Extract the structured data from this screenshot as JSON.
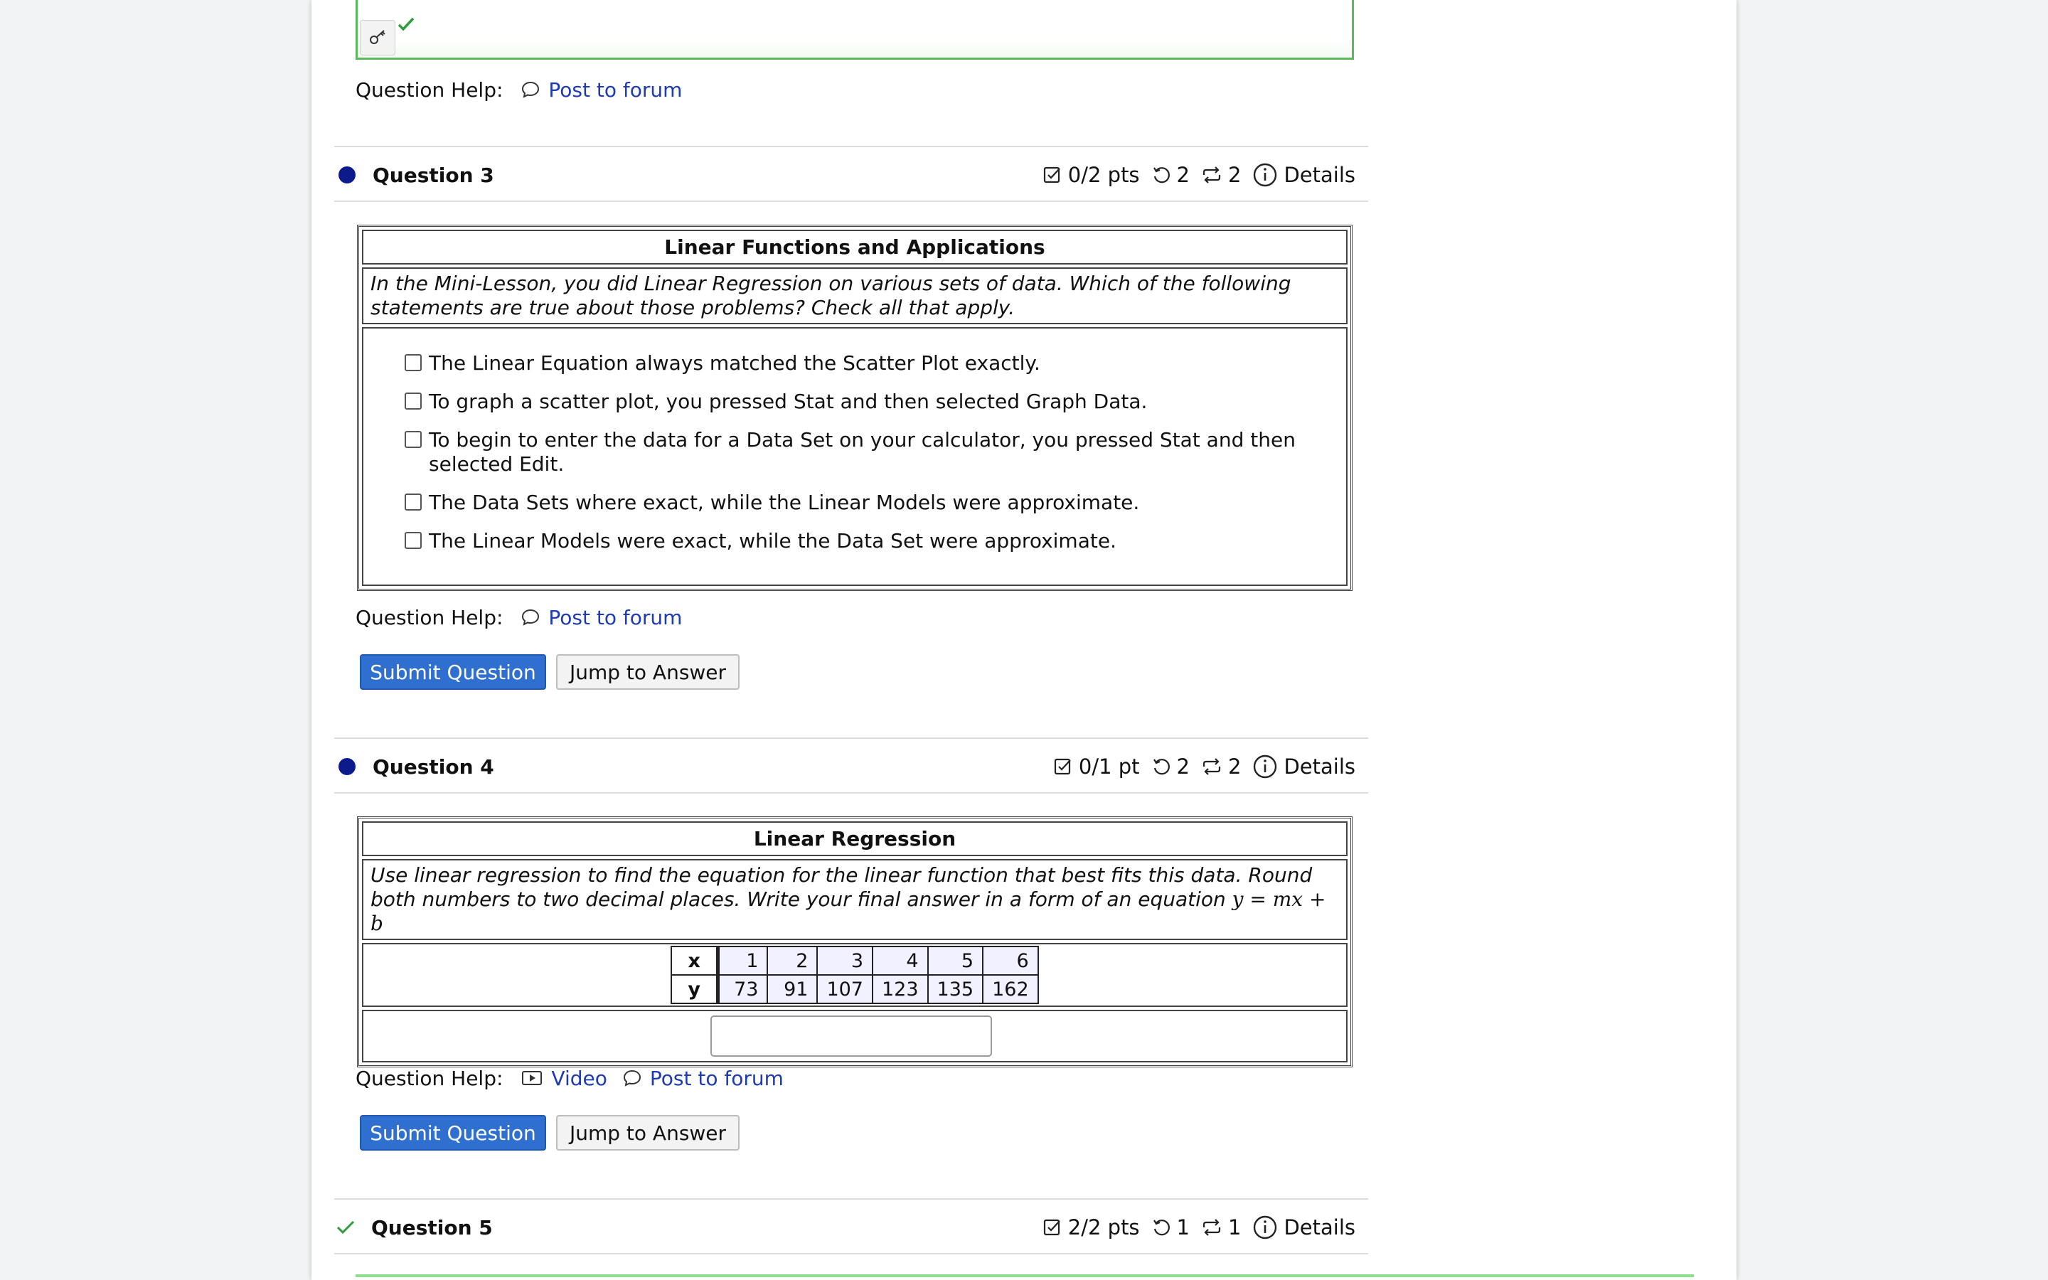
{
  "help_label": "Question Help:",
  "post_to_forum": "Post to forum",
  "video": "Video",
  "submit": "Submit Question",
  "jump": "Jump to Answer",
  "details": "Details",
  "colors": {
    "accent": "#2f6fcf",
    "link": "#1f3bb3",
    "dot": "#0d1a8c",
    "correct": "#2e9e3c"
  },
  "q3": {
    "title": "Question 3",
    "points": "0/2 pts",
    "retries": "2",
    "versions": "2",
    "box_title": "Linear Functions and Applications",
    "prompt": "In the Mini-Lesson, you did Linear Regression on various sets of data. Which of the following statements are true about those problems? Check all that apply.",
    "choices": [
      "The Linear Equation always matched the Scatter Plot exactly.",
      "To graph a scatter plot, you pressed Stat and then selected Graph Data.",
      "To begin to enter the data for a Data Set on your calculator, you pressed Stat and then selected Edit.",
      "The Data Sets where exact, while the Linear Models were approximate.",
      "The Linear Models were exact, while the Data Set were approximate."
    ]
  },
  "q4": {
    "title": "Question 4",
    "points": "0/1 pt",
    "retries": "2",
    "versions": "2",
    "box_title": "Linear Regression",
    "prompt": "Use linear regression to find the equation for the linear function that best fits this data. Round both numbers to two decimal places. Write your final answer in a form of an equation ",
    "equation": "y = mx + b",
    "table": {
      "x_label": "x",
      "y_label": "y",
      "x": [
        "1",
        "2",
        "3",
        "4",
        "5",
        "6"
      ],
      "y": [
        "73",
        "91",
        "107",
        "123",
        "135",
        "162"
      ]
    }
  },
  "q5": {
    "title": "Question 5",
    "points": "2/2 pts",
    "retries": "1",
    "versions": "1"
  }
}
